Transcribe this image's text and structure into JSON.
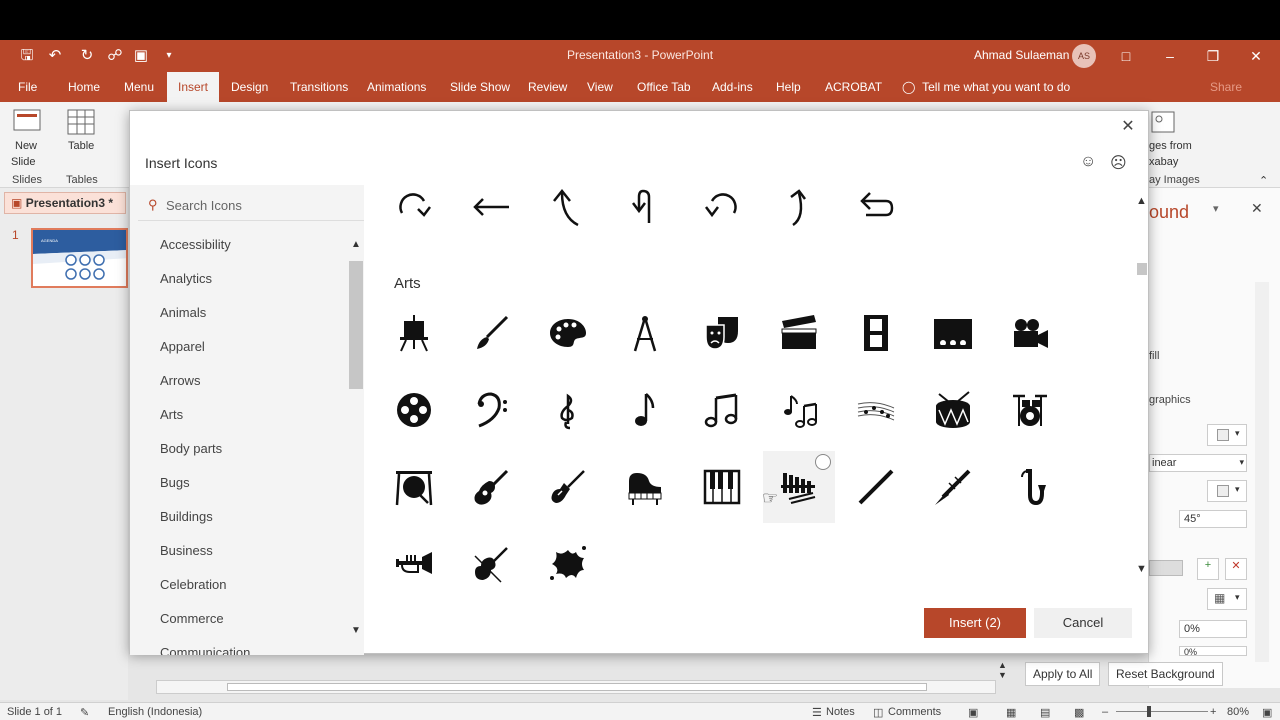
{
  "colors": {
    "accent": "#b7472a"
  },
  "app": {
    "title": "Presentation3 - PowerPoint",
    "user": "Ahmad Sulaeman",
    "user_initials": "AS"
  },
  "tabs": [
    "File",
    "Home",
    "Menu",
    "Insert",
    "Design",
    "Transitions",
    "Animations",
    "Slide Show",
    "Review",
    "View",
    "Office Tab",
    "Add-ins",
    "Help",
    "ACROBAT"
  ],
  "tell_me": "Tell me what you want to do",
  "share": "Share",
  "ribbon": {
    "new_slide": "New",
    "new_slide2": "Slide",
    "table": "Table",
    "slides_group": "Slides",
    "tables_group": "Tables",
    "images_from": "ges from",
    "pixabay": "xabay",
    "pixabay_images": "ay Images"
  },
  "file_tab": "Presentation3 *",
  "slide_number": "1",
  "thumb_text": "AGENDA",
  "right_pane": {
    "title_fragment": "ound",
    "fill": "fill",
    "graphics": "graphics",
    "type": "inear",
    "angle": "45°",
    "pct1": "0%",
    "pct2": "0%"
  },
  "dialog": {
    "title": "Insert Icons",
    "search_placeholder": "Search Icons",
    "categories": [
      "Accessibility",
      "Analytics",
      "Animals",
      "Apparel",
      "Arrows",
      "Arts",
      "Body parts",
      "Bugs",
      "Buildings",
      "Business",
      "Celebration",
      "Commerce",
      "Communication"
    ],
    "section_title": "Arts",
    "insert_label": "Insert (2)",
    "cancel_label": "Cancel"
  },
  "arrow_icons": [
    "arrow-redo-icon",
    "arrow-left-icon",
    "arrow-curved-up-left-icon",
    "arrow-u-turn-up-icon",
    "arrow-undo-icon",
    "arrow-curved-up-right-icon",
    "arrow-return-left-icon"
  ],
  "arts_icons": [
    "easel-icon",
    "paintbrush-icon",
    "palette-icon",
    "compass-icon",
    "theater-masks-icon",
    "clapperboard-icon",
    "film-strip-icon",
    "theater-stage-icon",
    "movie-camera-icon",
    "film-reel-icon",
    "bass-clef-icon",
    "treble-clef-icon",
    "music-note-icon",
    "music-notes-icon",
    "music-notes-pair-icon",
    "sheet-music-icon",
    "drum-icon",
    "drum-kit-icon",
    "gong-icon",
    "acoustic-guitar-icon",
    "electric-guitar-icon",
    "grand-piano-icon",
    "piano-keys-icon",
    "xylophone-icon",
    "flute-icon",
    "clarinet-icon",
    "saxophone-icon",
    "trumpet-icon",
    "violin-icon",
    "paint-splatter-icon"
  ],
  "bottom": {
    "apply_all": "Apply to All",
    "reset_bg": "Reset Background"
  },
  "status": {
    "slide": "Slide 1 of 1",
    "language": "English (Indonesia)",
    "notes": "Notes",
    "comments": "Comments",
    "zoom": "80%"
  }
}
